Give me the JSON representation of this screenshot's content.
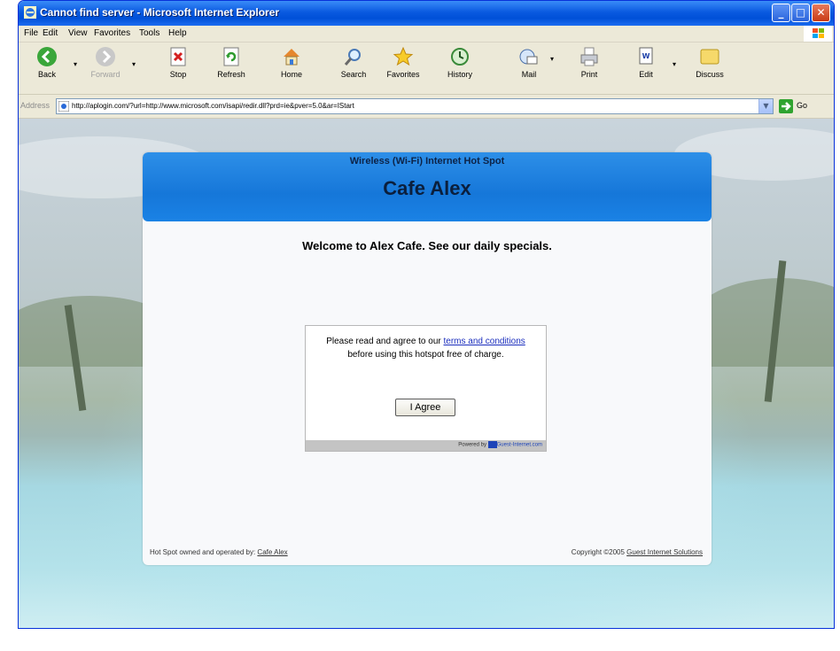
{
  "window": {
    "title": "Cannot find server - Microsoft Internet Explorer",
    "controls": {
      "minimize": "_",
      "maximize": "□",
      "close": "✕"
    }
  },
  "menu": {
    "items": [
      "File",
      "Edit",
      "View",
      "Favorites",
      "Tools",
      "Help"
    ]
  },
  "toolbar": {
    "back": "Back",
    "forward": "Forward",
    "stop": "Stop",
    "refresh": "Refresh",
    "home": "Home",
    "search": "Search",
    "favorites": "Favorites",
    "history": "History",
    "mail": "Mail",
    "print": "Print",
    "edit": "Edit",
    "discuss": "Discuss"
  },
  "address": {
    "label": "Address",
    "url": "http://aplogin.com/?url=http://www.microsoft.com/isapi/redir.dll?prd=ie&pver=5.0&ar=IStart",
    "go": "Go"
  },
  "page": {
    "subtitle": "Wireless (Wi-Fi) Internet Hot Spot",
    "title": "Cafe Alex",
    "welcome": "Welcome to Alex Cafe. See our daily specials.",
    "terms": {
      "before": "Please read and agree to our ",
      "link": "terms and conditions",
      "after": " before using this hotspot free of charge."
    },
    "agree_button": "I Agree",
    "powered_by": "Powered by",
    "powered_brand": "Guest-Internet.com",
    "footer": {
      "left_text": "Hot Spot owned and operated by: ",
      "left_link": "Cafe Alex",
      "right_text": "Copyright ©2005 ",
      "right_link": "Guest Internet Solutions"
    }
  },
  "colors": {
    "titlebar": "#0a5ae0",
    "header_blue": "#1677d9",
    "link": "#1a2dbd"
  }
}
